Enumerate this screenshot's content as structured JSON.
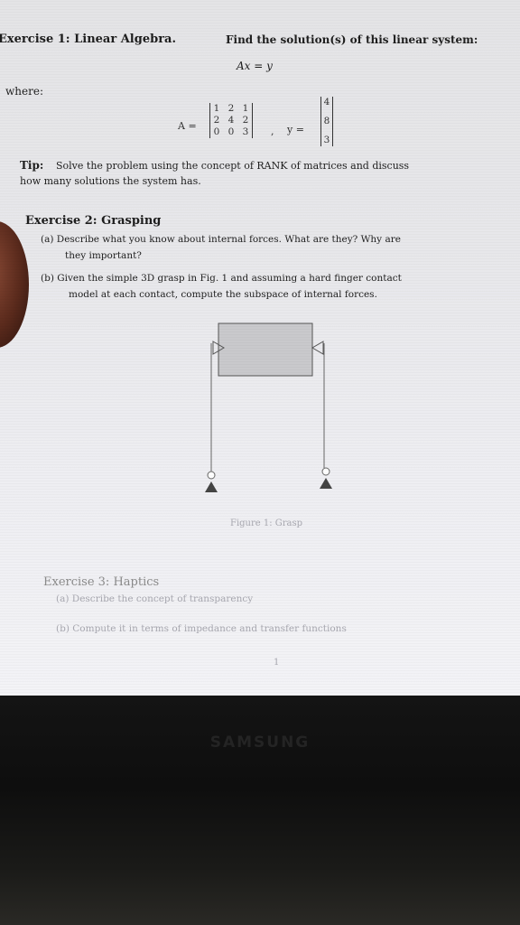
{
  "ex1": {
    "heading": "Exercise 1: Linear Algebra.",
    "prompt": "Find the solution(s) of this linear system:",
    "equation": "Ax = y",
    "where": "where:",
    "a_label": "A =",
    "y_label": "y =",
    "matrix_a": [
      [
        "1",
        "2",
        "1"
      ],
      [
        "2",
        "4",
        "2"
      ],
      [
        "0",
        "0",
        "3"
      ]
    ],
    "vector_y": [
      "4",
      "8",
      "3"
    ],
    "tip_label": "Tip:",
    "tip_line1": "Solve the problem using the concept of RANK of matrices and discuss",
    "tip_line2": "how many solutions the system has."
  },
  "ex2": {
    "heading": "Exercise 2: Grasping",
    "a_line1": "(a) Describe what you know about internal forces. What are they? Why are",
    "a_line2": "they important?",
    "b_line1": "(b) Given the simple 3D grasp in Fig. 1 and assuming a hard finger contact",
    "b_line2": "model at each contact, compute the subspace of internal forces.",
    "figure_caption": "Figure 1: Grasp"
  },
  "ex3": {
    "heading": "Exercise 3: Haptics",
    "a": "(a) Describe the concept of transparency",
    "b": "(b) Compute it in terms of impedance and transfer functions"
  },
  "page_number": "1",
  "brand": "SAMSUNG",
  "colors": {
    "screen": "#e6e6e9",
    "text": "#1e1e1e",
    "bezel": "#0e0e0e",
    "figure_box": "#c9c9cc"
  }
}
